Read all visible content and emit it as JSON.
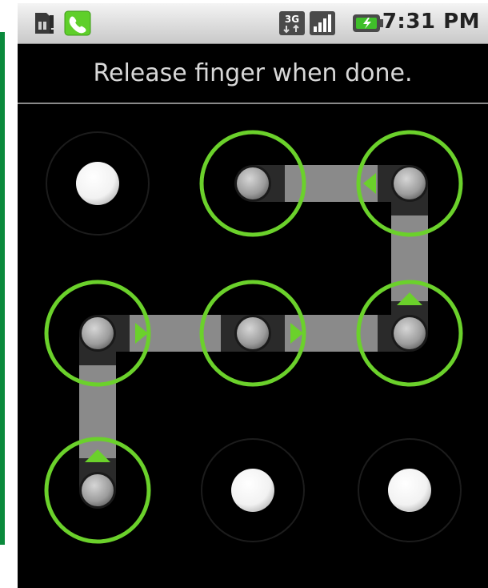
{
  "status_bar": {
    "time": "7:31 PM",
    "network_label": "3G",
    "icons": [
      "sim-alert-icon",
      "phone-call-icon",
      "network-3g-icon",
      "signal-icon",
      "battery-charging-icon"
    ]
  },
  "unlock": {
    "instruction": "Release finger when done.",
    "colors": {
      "active_ring": "#6bd12b",
      "arrow": "#6bd12b",
      "path": "#8a8a8a",
      "dot_inactive": "#ffffff",
      "dot_active": "#9a9a9a"
    },
    "pattern": [
      2,
      3,
      6,
      5,
      4,
      7
    ],
    "arrows": [
      {
        "cell": 3,
        "dir": "left"
      },
      {
        "cell": 6,
        "dir": "up"
      },
      {
        "cell": 4,
        "dir": "right"
      },
      {
        "cell": 5,
        "dir": "right"
      },
      {
        "cell": 7,
        "dir": "up"
      }
    ]
  }
}
